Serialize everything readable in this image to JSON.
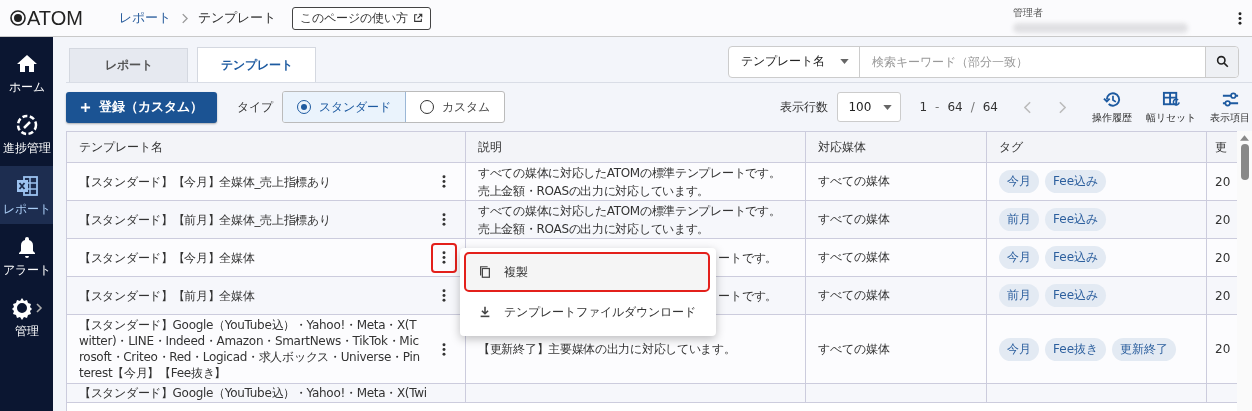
{
  "header": {
    "logo": "ATOM",
    "breadcrumb": [
      {
        "label": "レポート",
        "link": true
      },
      {
        "label": "テンプレート",
        "link": false
      }
    ],
    "help_button": "このページの使い方",
    "user_role": "管理者"
  },
  "sidebar": {
    "items": [
      {
        "label": "ホーム",
        "kind": "home",
        "selected": false
      },
      {
        "label": "進捗管理",
        "kind": "progress",
        "selected": false
      },
      {
        "label": "レポート",
        "kind": "sheet",
        "selected": true
      },
      {
        "label": "アラート",
        "kind": "bell",
        "selected": false
      },
      {
        "label": "管理",
        "kind": "gear",
        "selected": false
      }
    ]
  },
  "tabs": [
    {
      "label": "レポート",
      "selected": false
    },
    {
      "label": "テンプレート",
      "selected": true
    }
  ],
  "search": {
    "field_select": "テンプレート名",
    "placeholder": "検索キーワード（部分一致）"
  },
  "toolbar": {
    "add_button": "登録（カスタム）",
    "type_label": "タイプ",
    "type_options": [
      {
        "label": "スタンダード",
        "selected": true
      },
      {
        "label": "カスタム",
        "selected": false
      }
    ],
    "rows_label": "表示行数",
    "rows_per_page": "100",
    "range_start": "1",
    "range_separator": "-",
    "range_end": "64",
    "total_separator": "/",
    "total": "64",
    "actions": [
      {
        "label": "操作履歴",
        "kind": "history"
      },
      {
        "label": "幅リセット",
        "kind": "width"
      },
      {
        "label": "表示項目",
        "kind": "columns"
      }
    ]
  },
  "table": {
    "columns": [
      "テンプレート名",
      "説明",
      "対応媒体",
      "タグ",
      "更"
    ],
    "rows": [
      {
        "name": "【スタンダード】【今月】全媒体_売上指標あり",
        "description": [
          "すべての媒体に対応したATOMの標準テンプレートです。",
          "売上金額・ROASの出力に対応しています。"
        ],
        "media": "すべての媒体",
        "tags": [
          "今月",
          "Fee込み"
        ],
        "updated": "20",
        "menu_highlighted": false
      },
      {
        "name": "【スタンダード】【前月】全媒体_売上指標あり",
        "description": [
          "すべての媒体に対応したATOMの標準テンプレートです。",
          "売上金額・ROASの出力に対応しています。"
        ],
        "media": "すべての媒体",
        "tags": [
          "前月",
          "Fee込み"
        ],
        "updated": "20",
        "menu_highlighted": false
      },
      {
        "name": "【スタンダード】【今月】全媒体",
        "description": [
          "ートです。"
        ],
        "media": "すべての媒体",
        "tags": [
          "今月",
          "Fee込み"
        ],
        "updated": "20",
        "menu_highlighted": true
      },
      {
        "name": "【スタンダード】【前月】全媒体",
        "description": [
          "ートです。"
        ],
        "media": "すべての媒体",
        "tags": [
          "前月",
          "Fee込み"
        ],
        "updated": "20",
        "menu_highlighted": false
      },
      {
        "name": "【スタンダード】Google（YouTube込）・Yahoo!・Meta・X(Twitter)・LINE・Indeed・Amazon・SmartNews・TikTok・Microsoft・Criteo・Red・Logicad・求人ボックス・Universe・Pinterest【今月】【Fee抜き】",
        "description": [
          "【更新終了】主要媒体の出力に対応しています。"
        ],
        "media": "すべての媒体",
        "tags": [
          "今月",
          "Fee抜き",
          "更新終了"
        ],
        "updated": "20",
        "menu_highlighted": false
      },
      {
        "name": "【スタンダード】Google（YouTube込）・Yahoo!・Meta・X(Twi"
      }
    ]
  },
  "context_menu": {
    "items": [
      {
        "label": "複製",
        "kind": "copy",
        "highlighted": true
      },
      {
        "label": "テンプレートファイルダウンロード",
        "kind": "download",
        "highlighted": false
      }
    ]
  }
}
